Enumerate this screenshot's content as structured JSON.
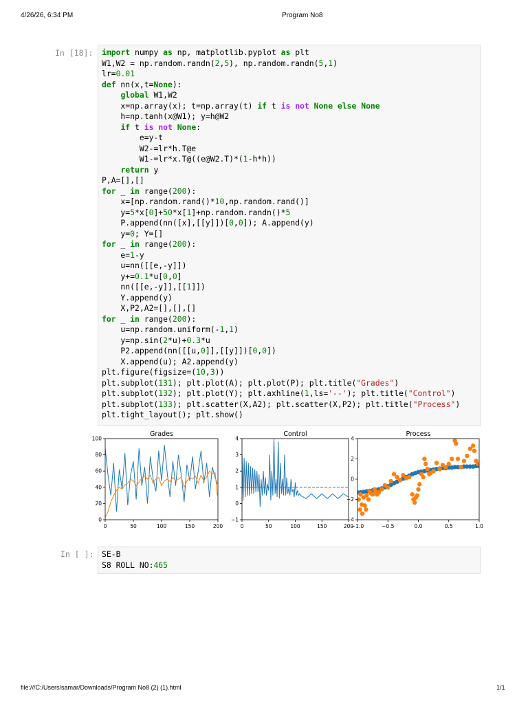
{
  "header": {
    "timestamp": "4/26/26, 6:34 PM",
    "title": "Program No8"
  },
  "footer": {
    "path": "file:///C:/Users/samar/Downloads/Program No8 (2) (1).html",
    "page": "1/1"
  },
  "cells": [
    {
      "prompt": "In [18]:",
      "code_lines": [
        "import numpy as np, matplotlib.pyplot as plt",
        "W1,W2 = np.random.randn(2,5), np.random.randn(5,1)",
        "lr=0.01",
        "def nn(x,t=None):",
        "    global W1,W2",
        "    x=np.array(x); t=np.array(t) if t is not None else None",
        "    h=np.tanh(x@W1); y=h@W2",
        "    if t is not None:",
        "        e=y-t",
        "        W2-=lr*h.T@e",
        "        W1-=lr*x.T@((e@W2.T)*(1-h*h))",
        "    return y",
        "P,A=[],[]",
        "for _ in range(200):",
        "    x=[np.random.rand()*10,np.random.rand()]",
        "    y=5*x[0]+50*x[1]+np.random.randn()*5",
        "    P.append(nn([x],[[y]])[0,0]); A.append(y)",
        "    y=0; Y=[]",
        "for _ in range(200):",
        "    e=1-y",
        "    u=nn([[e,-y]])",
        "    y+=0.1*u[0,0]",
        "    nn([[e,-y]],[[1]])",
        "    Y.append(y)",
        "    X,P2,A2=[],[],[]",
        "for _ in range(200):",
        "    u=np.random.uniform(-1,1)",
        "    y=np.sin(2*u)+0.3*u",
        "    P2.append(nn([[u,0]],[[y]])[0,0])",
        "    X.append(u); A2.append(y)",
        "plt.figure(figsize=(10,3))",
        "plt.subplot(131); plt.plot(A); plt.plot(P); plt.title(\"Grades\")",
        "plt.subplot(132); plt.plot(Y); plt.axhline(1,ls='--'); plt.title(\"Control\")",
        "plt.subplot(133); plt.scatter(X,A2); plt.scatter(X,P2); plt.title(\"Process\")",
        "plt.tight_layout(); plt.show()"
      ]
    },
    {
      "prompt": "In [ ]:",
      "code_lines": [
        "SE-B",
        "S8 ROLL NO:465"
      ]
    }
  ],
  "colors": {
    "blue": "#1f77b4",
    "orange": "#ff7f0e"
  },
  "chart_data": [
    {
      "type": "line",
      "title": "Grades",
      "xlim": [
        0,
        200
      ],
      "ylim": [
        0,
        100
      ],
      "xticks": [
        0,
        50,
        100,
        150,
        200
      ],
      "yticks": [
        0,
        20,
        40,
        60,
        80,
        100
      ],
      "series": [
        {
          "x": [
            0,
            5,
            10,
            15,
            20,
            25,
            30,
            35,
            40,
            45,
            50,
            55,
            60,
            65,
            70,
            75,
            80,
            85,
            90,
            95,
            100,
            105,
            110,
            115,
            120,
            125,
            130,
            135,
            140,
            145,
            150,
            155,
            160,
            165,
            170,
            175,
            180,
            185,
            190,
            195,
            199
          ],
          "values": [
            88,
            55,
            30,
            70,
            10,
            62,
            38,
            82,
            18,
            55,
            72,
            25,
            88,
            42,
            65,
            20,
            78,
            50,
            35,
            85,
            48,
            92,
            58,
            28,
            72,
            42,
            80,
            55,
            22,
            68,
            48,
            78,
            38,
            60,
            85,
            45,
            70,
            28,
            65,
            52,
            44
          ]
        },
        {
          "x": [
            0,
            5,
            10,
            15,
            20,
            25,
            30,
            35,
            40,
            45,
            50,
            55,
            60,
            65,
            70,
            75,
            80,
            85,
            90,
            95,
            100,
            105,
            110,
            115,
            120,
            125,
            130,
            135,
            140,
            145,
            150,
            155,
            160,
            165,
            170,
            175,
            180,
            185,
            190,
            195,
            199
          ],
          "values": [
            3,
            10,
            22,
            30,
            36,
            40,
            38,
            43,
            45,
            50,
            48,
            42,
            46,
            52,
            54,
            50,
            55,
            45,
            50,
            52,
            42,
            48,
            50,
            47,
            52,
            48,
            50,
            53,
            40,
            48,
            52,
            50,
            54,
            45,
            55,
            48,
            53,
            60,
            57,
            58,
            30
          ]
        }
      ]
    },
    {
      "type": "line",
      "title": "Control",
      "xlim": [
        0,
        200
      ],
      "ylim": [
        -1,
        4
      ],
      "xticks": [
        0,
        50,
        100,
        150,
        200
      ],
      "yticks": [
        -1,
        0,
        1,
        2,
        3,
        4
      ],
      "hline": 1,
      "series": [
        {
          "x": [
            0,
            2,
            4,
            6,
            8,
            10,
            12,
            14,
            16,
            18,
            20,
            22,
            24,
            26,
            28,
            30,
            32,
            34,
            36,
            38,
            40,
            42,
            44,
            46,
            48,
            50,
            52,
            54,
            56,
            58,
            60,
            62,
            64,
            66,
            68,
            70,
            72,
            74,
            76,
            78,
            80,
            82,
            84,
            86,
            88,
            90,
            92,
            94,
            96,
            98,
            100,
            102,
            104,
            106,
            108,
            110,
            120,
            130,
            140,
            150,
            160,
            170,
            180,
            190,
            200
          ],
          "values": [
            3.0,
            0.2,
            2.8,
            0.4,
            2.6,
            0.5,
            2.5,
            0.5,
            2.3,
            0.6,
            2.2,
            0.6,
            2.1,
            0.7,
            2.0,
            0.7,
            1.8,
            -0.2,
            1.5,
            0.5,
            2.0,
            0.6,
            1.6,
            0.5,
            1.2,
            0.8,
            3.0,
            0.2,
            2.0,
            0.5,
            4.0,
            0.6,
            1.5,
            0.4,
            3.8,
            0.3,
            2.5,
            0.6,
            1.5,
            0.5,
            3.0,
            0.5,
            1.6,
            0.6,
            1.0,
            0.5,
            1.5,
            0.7,
            0.9,
            0.4,
            1.3,
            0.5,
            0.8,
            0.5,
            0.6,
            0.5,
            0.3,
            0.6,
            0.3,
            0.6,
            0.3,
            0.6,
            0.3,
            0.6,
            0.4
          ]
        }
      ]
    },
    {
      "type": "scatter",
      "title": "Process",
      "xlim": [
        -1,
        1
      ],
      "ylim": [
        -4,
        4
      ],
      "xticks": [
        -1.0,
        -0.5,
        0.0,
        0.5,
        1.0
      ],
      "yticks": [
        -4,
        -2,
        0,
        2,
        4
      ],
      "series": [
        {
          "x": [
            -1.0,
            -0.95,
            -0.9,
            -0.85,
            -0.8,
            -0.75,
            -0.7,
            -0.65,
            -0.6,
            -0.55,
            -0.5,
            -0.45,
            -0.4,
            -0.35,
            -0.3,
            -0.25,
            -0.2,
            -0.15,
            -0.1,
            -0.05,
            0.0,
            0.05,
            0.1,
            0.15,
            0.2,
            0.25,
            0.3,
            0.35,
            0.4,
            0.45,
            0.5,
            0.55,
            0.6,
            0.65,
            0.7,
            0.75,
            0.8,
            0.85,
            0.9,
            0.95,
            1.0
          ],
          "values": [
            -1.3,
            -1.3,
            -1.25,
            -1.2,
            -1.15,
            -1.1,
            -1.05,
            -1.0,
            -0.9,
            -0.8,
            -0.7,
            -0.55,
            -0.4,
            -0.25,
            -0.1,
            0.05,
            0.2,
            0.35,
            0.5,
            0.6,
            0.7,
            0.75,
            0.8,
            0.85,
            0.9,
            0.95,
            1.0,
            1.05,
            1.1,
            1.1,
            1.15,
            1.15,
            1.2,
            1.2,
            1.2,
            1.25,
            1.25,
            1.25,
            1.25,
            1.3,
            1.3
          ]
        },
        {
          "x": [
            -0.98,
            -0.96,
            -0.95,
            -0.93,
            -0.92,
            -0.9,
            -0.88,
            -0.86,
            -0.85,
            -0.82,
            -0.8,
            -0.78,
            -0.75,
            -0.72,
            -0.7,
            -0.68,
            -0.65,
            -0.6,
            -0.55,
            -0.5,
            -0.45,
            -0.4,
            -0.35,
            -0.3,
            -0.25,
            -0.2,
            -0.15,
            -0.1,
            -0.08,
            -0.06,
            -0.04,
            -0.02,
            0.0,
            0.02,
            0.05,
            0.08,
            0.1,
            0.12,
            0.15,
            0.18,
            0.2,
            0.25,
            0.3,
            0.35,
            0.4,
            0.45,
            0.5,
            0.55,
            0.6,
            0.62,
            0.65,
            0.7,
            0.75,
            0.8,
            0.85,
            0.9,
            0.92,
            0.95,
            0.98
          ],
          "values": [
            -2.0,
            -3.0,
            -1.5,
            -2.5,
            -3.4,
            -1.8,
            -2.6,
            -3.0,
            -1.6,
            -2.0,
            -1.2,
            -1.4,
            -1.5,
            -1.0,
            -1.2,
            -1.5,
            -1.3,
            -1.0,
            -0.6,
            -0.8,
            -0.2,
            0.5,
            0.2,
            -0.1,
            0.4,
            0.1,
            0.2,
            -1.5,
            -2.0,
            -2.3,
            -1.8,
            -1.6,
            -1.0,
            -0.5,
            0.5,
            0.2,
            2.0,
            1.5,
            1.0,
            0.5,
            0.6,
            0.8,
            1.6,
            1.0,
            1.4,
            1.2,
            1.5,
            2.0,
            3.8,
            3.5,
            2.0,
            1.2,
            1.8,
            2.3,
            3.0,
            3.3,
            2.8,
            1.8,
            1.5
          ]
        }
      ]
    }
  ],
  "cell2_lines_display": [
    "SE-B",
    "S8 ROLL NO:465"
  ]
}
